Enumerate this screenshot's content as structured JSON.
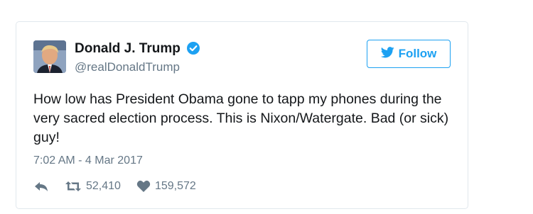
{
  "user": {
    "display_name": "Donald J. Trump",
    "handle": "@realDonaldTrump",
    "verified": true
  },
  "follow_button": {
    "label": "Follow"
  },
  "tweet": {
    "text": "How low has President Obama gone to tapp my phones during the very sacred election process. This is Nixon/Watergate. Bad (or sick) guy!",
    "timestamp": "7:02 AM - 4 Mar 2017"
  },
  "actions": {
    "retweets": "52,410",
    "likes": "159,572"
  },
  "colors": {
    "brand": "#1da1f2",
    "text": "#14171a",
    "muted": "#657786",
    "border": "#e1e8ed"
  },
  "icons": [
    "avatar",
    "verified-icon",
    "twitter-bird-icon",
    "reply-icon",
    "retweet-icon",
    "heart-icon"
  ]
}
